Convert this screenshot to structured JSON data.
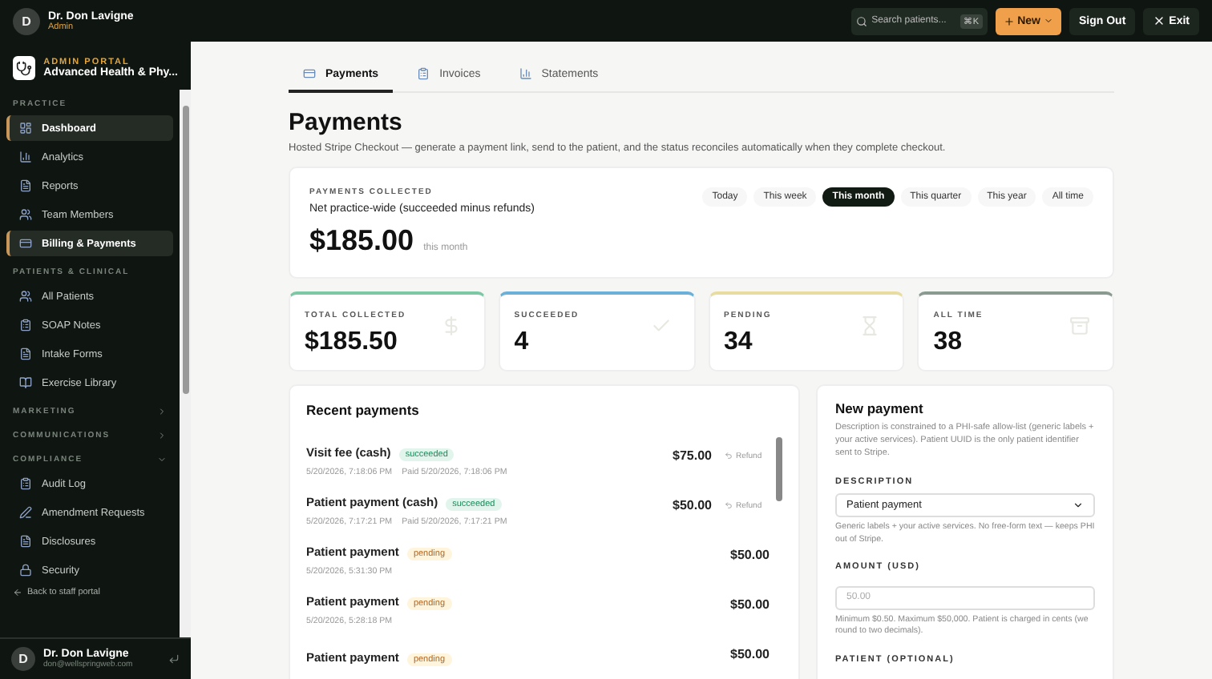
{
  "topbar": {
    "user": {
      "initial": "D",
      "name": "Dr. Don Lavigne",
      "role": "Admin"
    },
    "search": {
      "placeholder": "Search patients...",
      "shortcut": "⌘K"
    },
    "new_button": "New",
    "buttons": [
      {
        "kind": "plain",
        "label": "Sign Out"
      },
      {
        "kind": "exit",
        "label": "Exit"
      }
    ]
  },
  "sidebar": {
    "brand": {
      "kicker": "ADMIN PORTAL",
      "name": "Advanced Health & Phy..."
    },
    "sections": [
      {
        "title": "PRACTICE",
        "kind": "open",
        "items": [
          {
            "label": "Dashboard",
            "selected": true
          },
          {
            "label": "Analytics",
            "selected": false
          },
          {
            "label": "Reports",
            "selected": false
          },
          {
            "label": "Team Members",
            "selected": false
          },
          {
            "label": "Billing & Payments",
            "selected": true
          }
        ]
      },
      {
        "title": "PATIENTS & CLINICAL",
        "kind": "open",
        "items": [
          {
            "label": "All Patients",
            "selected": false
          },
          {
            "label": "SOAP Notes",
            "selected": false
          },
          {
            "label": "Intake Forms",
            "selected": false
          },
          {
            "label": "Exercise Library",
            "selected": false
          }
        ]
      },
      {
        "title": "MARKETING",
        "kind": "collapsible",
        "expanded": false
      },
      {
        "title": "COMMUNICATIONS",
        "kind": "collapsible",
        "expanded": false
      },
      {
        "title": "COMPLIANCE",
        "kind": "collapsible",
        "expanded": true,
        "items": [
          {
            "label": "Audit Log",
            "selected": false
          },
          {
            "label": "Amendment Requests",
            "selected": false
          },
          {
            "label": "Disclosures",
            "selected": false
          },
          {
            "label": "Security",
            "selected": false
          }
        ]
      }
    ],
    "back_link": "Back to staff portal",
    "footer": {
      "initial": "D",
      "name": "Dr. Don Lavigne",
      "email": "don@wellspringweb.com"
    }
  },
  "tabs": [
    {
      "label": "Payments",
      "selected": true
    },
    {
      "label": "Invoices",
      "selected": false
    },
    {
      "label": "Statements",
      "selected": false
    }
  ],
  "page": {
    "title": "Payments",
    "subtitle": "Hosted Stripe Checkout — generate a payment link, send to the patient, and the status reconciles automatically when they complete checkout."
  },
  "collected": {
    "label": "PAYMENTS COLLECTED",
    "sublabel": "Net practice-wide (succeeded minus refunds)",
    "amount": "$185.00",
    "period": "this month",
    "ranges": [
      {
        "label": "Today",
        "selected": false
      },
      {
        "label": "This week",
        "selected": false
      },
      {
        "label": "This month",
        "selected": true
      },
      {
        "label": "This quarter",
        "selected": false
      },
      {
        "label": "This year",
        "selected": false
      },
      {
        "label": "All time",
        "selected": false
      }
    ]
  },
  "stats": [
    {
      "label": "TOTAL COLLECTED",
      "value": "$185.50",
      "color": "#7cc8a4"
    },
    {
      "label": "SUCCEEDED",
      "value": "4",
      "color": "#6ab0d8"
    },
    {
      "label": "PENDING",
      "value": "34",
      "color": "#e8dca0"
    },
    {
      "label": "ALL TIME",
      "value": "38",
      "color": "#8a9a90"
    }
  ],
  "recent": {
    "title": "Recent payments",
    "rows": [
      {
        "title": "Visit fee (cash)",
        "status": "succeeded",
        "created": "5/20/2026, 7:18:06 PM",
        "paid": "Paid 5/20/2026, 7:18:06 PM",
        "amount": "$75.00",
        "refund": "Refund"
      },
      {
        "title": "Patient payment (cash)",
        "status": "succeeded",
        "created": "5/20/2026, 7:17:21 PM",
        "paid": "Paid 5/20/2026, 7:17:21 PM",
        "amount": "$50.00",
        "refund": "Refund"
      },
      {
        "title": "Patient payment",
        "status": "pending",
        "created": "5/20/2026, 5:31:30 PM",
        "amount": "$50.00"
      },
      {
        "title": "Patient payment",
        "status": "pending",
        "created": "5/20/2026, 5:28:18 PM",
        "amount": "$50.00"
      },
      {
        "title": "Patient payment",
        "status": "pending",
        "amount": "$50.00"
      }
    ]
  },
  "new_payment": {
    "title": "New payment",
    "description": "Description is constrained to a PHI-safe allow-list (generic labels + your active services). Patient UUID is the only patient identifier sent to Stripe.",
    "fields": [
      {
        "kind": "select",
        "label": "DESCRIPTION",
        "value": "Patient payment",
        "hint": "Generic labels + your active services. No free-form text — keeps PHI out of Stripe."
      },
      {
        "kind": "input",
        "label": "AMOUNT (USD)",
        "placeholder": "50.00",
        "hint": "Minimum $0.50. Maximum $50,000. Patient is charged in cents (we round to two decimals)."
      },
      {
        "kind": "label",
        "label": "PATIENT (OPTIONAL)"
      }
    ]
  }
}
